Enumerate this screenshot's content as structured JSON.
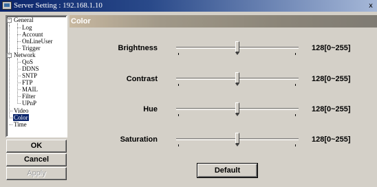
{
  "window": {
    "title": "Server Setting : 192.168.1.10",
    "close_label": "x"
  },
  "tree": {
    "items": [
      {
        "label": "General",
        "expander": "−"
      },
      {
        "label": "Log"
      },
      {
        "label": "Account"
      },
      {
        "label": "OnLineUser"
      },
      {
        "label": "Trigger"
      },
      {
        "label": "Network",
        "expander": "−"
      },
      {
        "label": "QoS"
      },
      {
        "label": "DDNS"
      },
      {
        "label": "SNTP"
      },
      {
        "label": "FTP"
      },
      {
        "label": "MAIL"
      },
      {
        "label": "Filter"
      },
      {
        "label": "UPnP"
      },
      {
        "label": "Video"
      },
      {
        "label": "Color",
        "selected": true
      },
      {
        "label": "Time"
      }
    ]
  },
  "buttons": {
    "ok": "OK",
    "cancel": "Cancel",
    "apply": "Apply",
    "default": "Default"
  },
  "panel": {
    "title": "Color",
    "settings": [
      {
        "label": "Brightness",
        "value": 128,
        "display": "128[0~255]",
        "min": 0,
        "max": 255
      },
      {
        "label": "Contrast",
        "value": 128,
        "display": "128[0~255]",
        "min": 0,
        "max": 255
      },
      {
        "label": "Hue",
        "value": 128,
        "display": "128[0~255]",
        "min": 0,
        "max": 255
      },
      {
        "label": "Saturation",
        "value": 128,
        "display": "128[0~255]",
        "min": 0,
        "max": 255
      }
    ]
  }
}
